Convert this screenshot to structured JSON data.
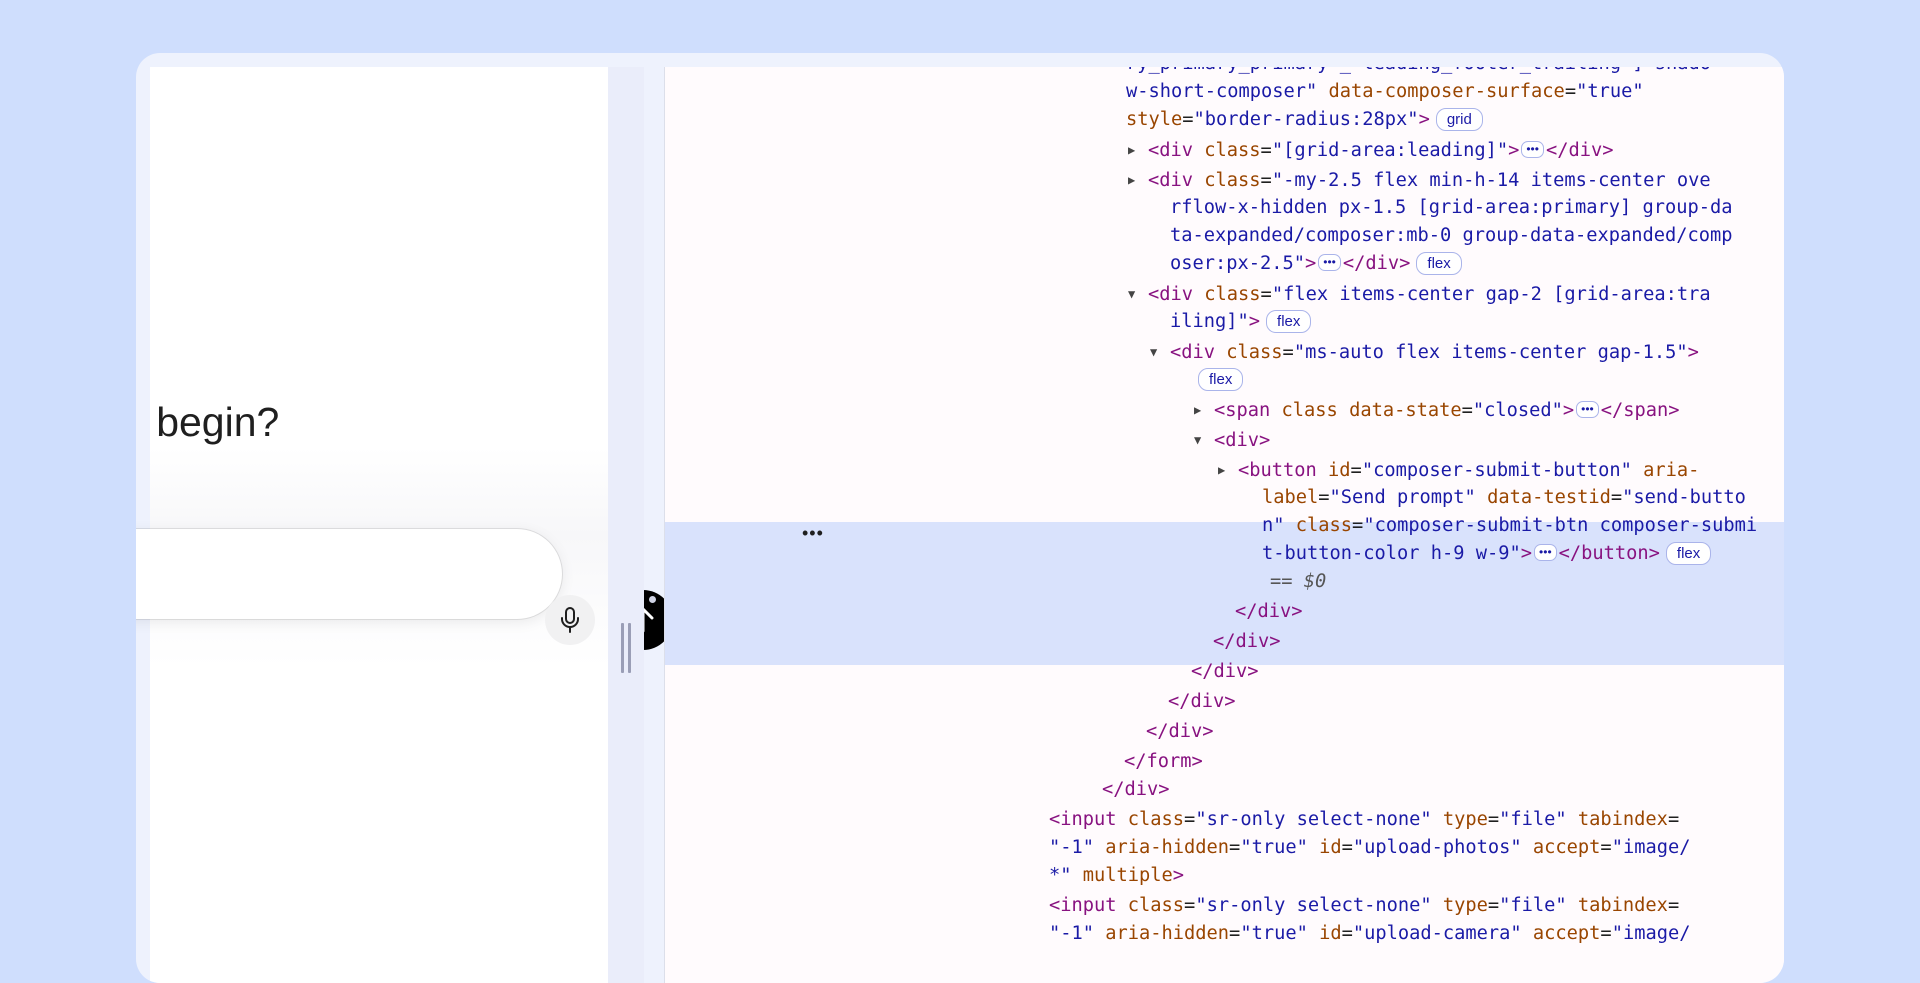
{
  "page": {
    "heading": "e begin?",
    "mic_icon": "microphone-icon",
    "send_icon": "arrow-up-icon"
  },
  "colors": {
    "background": "#cfdefd",
    "selection": "#d9e2fc",
    "tag": "#881280",
    "attr_name": "#994500",
    "attr_value": "#1a1aa6",
    "send_button": "#000000"
  },
  "devtools": {
    "selected_marker": "== $0",
    "row_menu": "•••",
    "lines": [
      {
        "tokens": [
          [
            "v",
            "ry_primary_primary'_'leading_footer_trailing'] shado"
          ]
        ]
      },
      {
        "tokens": [
          [
            "v",
            "w-short-composer\""
          ],
          [
            "txt",
            " "
          ],
          [
            "a",
            "data-composer-surface"
          ],
          [
            "txt",
            "="
          ],
          [
            "v",
            "\"true\""
          ]
        ]
      },
      {
        "tokens": [
          [
            "a",
            "style"
          ],
          [
            "txt",
            "="
          ],
          [
            "v",
            "\"border-radius:28px\""
          ],
          [
            "t",
            ">"
          ]
        ],
        "badge": "grid"
      },
      {
        "tri": "▶",
        "tokens": [
          [
            "t",
            "<div"
          ],
          [
            "txt",
            " "
          ],
          [
            "a",
            "class"
          ],
          [
            "txt",
            "="
          ],
          [
            "v",
            "\"[grid-area:leading]\""
          ],
          [
            "t",
            ">"
          ]
        ],
        "ellipsis": true,
        "close": "</div>"
      },
      {
        "tri": "▶",
        "tokens": [
          [
            "t",
            "<div"
          ],
          [
            "txt",
            " "
          ],
          [
            "a",
            "class"
          ],
          [
            "txt",
            "="
          ],
          [
            "v",
            "\"-my-2.5 flex min-h-14 items-center ove"
          ]
        ]
      },
      {
        "tokens": [
          [
            "v",
            "rflow-x-hidden px-1.5 [grid-area:primary] group-da"
          ]
        ]
      },
      {
        "tokens": [
          [
            "v",
            "ta-expanded/composer:mb-0 group-data-expanded/comp"
          ]
        ]
      },
      {
        "tokens": [
          [
            "v",
            "oser:px-2.5\""
          ],
          [
            "t",
            ">"
          ]
        ],
        "ellipsis": true,
        "close": "</div>",
        "badge": "flex"
      },
      {
        "tri": "▼",
        "tokens": [
          [
            "t",
            "<div"
          ],
          [
            "txt",
            " "
          ],
          [
            "a",
            "class"
          ],
          [
            "txt",
            "="
          ],
          [
            "v",
            "\"flex items-center gap-2 [grid-area:tra"
          ]
        ]
      },
      {
        "tokens": [
          [
            "v",
            "iling]\""
          ],
          [
            "t",
            ">"
          ]
        ],
        "badge": "flex"
      },
      {
        "tri": "▼",
        "tokens": [
          [
            "t",
            "<div"
          ],
          [
            "txt",
            " "
          ],
          [
            "a",
            "class"
          ],
          [
            "txt",
            "="
          ],
          [
            "v",
            "\"ms-auto flex items-center gap-1.5\""
          ],
          [
            "t",
            ">"
          ]
        ]
      },
      {
        "tokens": [],
        "badge": "flex"
      },
      {
        "tri": "▶",
        "tokens": [
          [
            "t",
            "<span"
          ],
          [
            "txt",
            " "
          ],
          [
            "a",
            "class"
          ],
          [
            "txt",
            " "
          ],
          [
            "a",
            "data-state"
          ],
          [
            "txt",
            "="
          ],
          [
            "v",
            "\"closed\""
          ],
          [
            "t",
            ">"
          ]
        ],
        "ellipsis": true,
        "close": "</span>"
      },
      {
        "tri": "▼",
        "tokens": [
          [
            "t",
            "<div>"
          ]
        ]
      },
      {
        "tri": "▶",
        "tokens": [
          [
            "t",
            "<button"
          ],
          [
            "txt",
            " "
          ],
          [
            "a",
            "id"
          ],
          [
            "txt",
            "="
          ],
          [
            "v",
            "\"composer-submit-button\""
          ],
          [
            "txt",
            " "
          ],
          [
            "a",
            "aria-"
          ]
        ]
      },
      {
        "tokens": [
          [
            "a",
            "label"
          ],
          [
            "txt",
            "="
          ],
          [
            "v",
            "\"Send prompt\""
          ],
          [
            "txt",
            " "
          ],
          [
            "a",
            "data-testid"
          ],
          [
            "txt",
            "="
          ],
          [
            "v",
            "\"send-butto"
          ]
        ]
      },
      {
        "tokens": [
          [
            "v",
            "n\""
          ],
          [
            "txt",
            " "
          ],
          [
            "a",
            "class"
          ],
          [
            "txt",
            "="
          ],
          [
            "v",
            "\"composer-submit-btn composer-submi"
          ]
        ]
      },
      {
        "tokens": [
          [
            "v",
            "t-button-color h-9 w-9\""
          ],
          [
            "t",
            ">"
          ]
        ],
        "ellipsis": true,
        "close": "</button>",
        "badge": "flex"
      },
      {
        "tokens": [],
        "marker": true
      },
      {
        "tokens": [
          [
            "t",
            "</div>"
          ]
        ]
      },
      {
        "tokens": [
          [
            "t",
            "</div>"
          ]
        ]
      },
      {
        "tokens": [
          [
            "t",
            "</div>"
          ]
        ]
      },
      {
        "tokens": [
          [
            "t",
            "</div>"
          ]
        ]
      },
      {
        "tokens": [
          [
            "t",
            "</div>"
          ]
        ]
      },
      {
        "tokens": [
          [
            "t",
            "</form>"
          ]
        ]
      },
      {
        "tokens": [
          [
            "t",
            "</div>"
          ]
        ]
      },
      {
        "tokens": [
          [
            "t",
            "<input"
          ],
          [
            "txt",
            " "
          ],
          [
            "a",
            "class"
          ],
          [
            "txt",
            "="
          ],
          [
            "v",
            "\"sr-only select-none\""
          ],
          [
            "txt",
            " "
          ],
          [
            "a",
            "type"
          ],
          [
            "txt",
            "="
          ],
          [
            "v",
            "\"file\""
          ],
          [
            "txt",
            " "
          ],
          [
            "a",
            "tabindex"
          ],
          [
            "txt",
            "="
          ]
        ]
      },
      {
        "tokens": [
          [
            "v",
            "\"-1\""
          ],
          [
            "txt",
            " "
          ],
          [
            "a",
            "aria-hidden"
          ],
          [
            "txt",
            "="
          ],
          [
            "v",
            "\"true\""
          ],
          [
            "txt",
            " "
          ],
          [
            "a",
            "id"
          ],
          [
            "txt",
            "="
          ],
          [
            "v",
            "\"upload-photos\""
          ],
          [
            "txt",
            " "
          ],
          [
            "a",
            "accept"
          ],
          [
            "txt",
            "="
          ],
          [
            "v",
            "\"image/"
          ]
        ]
      },
      {
        "tokens": [
          [
            "v",
            "*\""
          ],
          [
            "txt",
            " "
          ],
          [
            "a",
            "multiple"
          ],
          [
            "t",
            ">"
          ]
        ]
      },
      {
        "tokens": [
          [
            "t",
            "<input"
          ],
          [
            "txt",
            " "
          ],
          [
            "a",
            "class"
          ],
          [
            "txt",
            "="
          ],
          [
            "v",
            "\"sr-only select-none\""
          ],
          [
            "txt",
            " "
          ],
          [
            "a",
            "type"
          ],
          [
            "txt",
            "="
          ],
          [
            "v",
            "\"file\""
          ],
          [
            "txt",
            " "
          ],
          [
            "a",
            "tabindex"
          ],
          [
            "txt",
            "="
          ]
        ]
      },
      {
        "tokens": [
          [
            "v",
            "\"-1\""
          ],
          [
            "txt",
            " "
          ],
          [
            "a",
            "aria-hidden"
          ],
          [
            "txt",
            "="
          ],
          [
            "v",
            "\"true\""
          ],
          [
            "txt",
            " "
          ],
          [
            "a",
            "id"
          ],
          [
            "txt",
            "="
          ],
          [
            "v",
            "\"upload-camera\""
          ],
          [
            "txt",
            " "
          ],
          [
            "a",
            "accept"
          ],
          [
            "txt",
            "="
          ],
          [
            "v",
            "\"image/"
          ]
        ]
      }
    ]
  }
}
